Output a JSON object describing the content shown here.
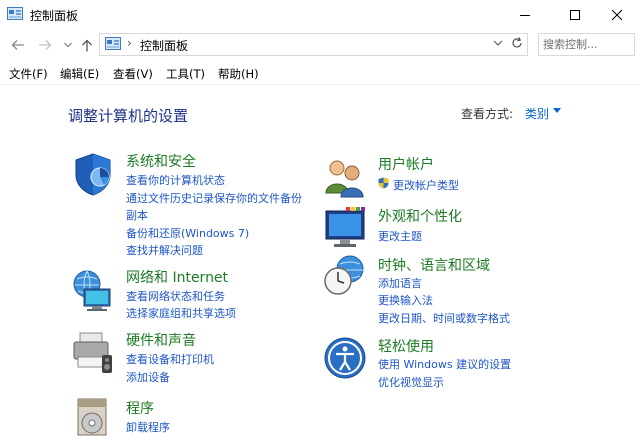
{
  "window": {
    "title": "控制面板"
  },
  "address": {
    "breadcrumb": "控制面板",
    "separator": "›",
    "search_placeholder": "搜索控制..."
  },
  "menu": [
    {
      "label": "文件(F)"
    },
    {
      "label": "编辑(E)"
    },
    {
      "label": "查看(V)"
    },
    {
      "label": "工具(T)"
    },
    {
      "label": "帮助(H)"
    }
  ],
  "content": {
    "heading": "调整计算机的设置",
    "view_by_label": "查看方式:",
    "view_by_value": "类别"
  },
  "categories": [
    {
      "title": "系统和安全",
      "icon": "system-security-icon",
      "links": [
        "查看你的计算机状态",
        "通过文件历史记录保存你的文件备份",
        "副本",
        "备份和还原(Windows 7)",
        "查找并解决问题"
      ]
    },
    {
      "title": "网络和 Internet",
      "icon": "network-icon",
      "links": [
        "查看网络状态和任务",
        "选择家庭组和共享选项"
      ]
    },
    {
      "title": "硬件和声音",
      "icon": "hardware-sound-icon",
      "links": [
        "查看设备和打印机",
        "添加设备"
      ]
    },
    {
      "title": "程序",
      "icon": "programs-icon",
      "links": [
        "卸载程序"
      ]
    },
    {
      "title": "用户帐户",
      "icon": "user-accounts-icon",
      "links": [
        "更改帐户类型"
      ]
    },
    {
      "title": "外观和个性化",
      "icon": "appearance-icon",
      "links": [
        "更改主题"
      ]
    },
    {
      "title": "时钟、语言和区域",
      "icon": "clock-region-icon",
      "links": [
        "添加语言",
        "更换输入法",
        "更改日期、时间或数字格式"
      ]
    },
    {
      "title": "轻松使用",
      "icon": "ease-of-access-icon",
      "links": [
        "使用 Windows 建议的设置",
        "优化视觉显示"
      ]
    }
  ],
  "colors": {
    "category_title": "#1b7b23",
    "link": "#1e56c5",
    "heading": "#1e3287"
  }
}
